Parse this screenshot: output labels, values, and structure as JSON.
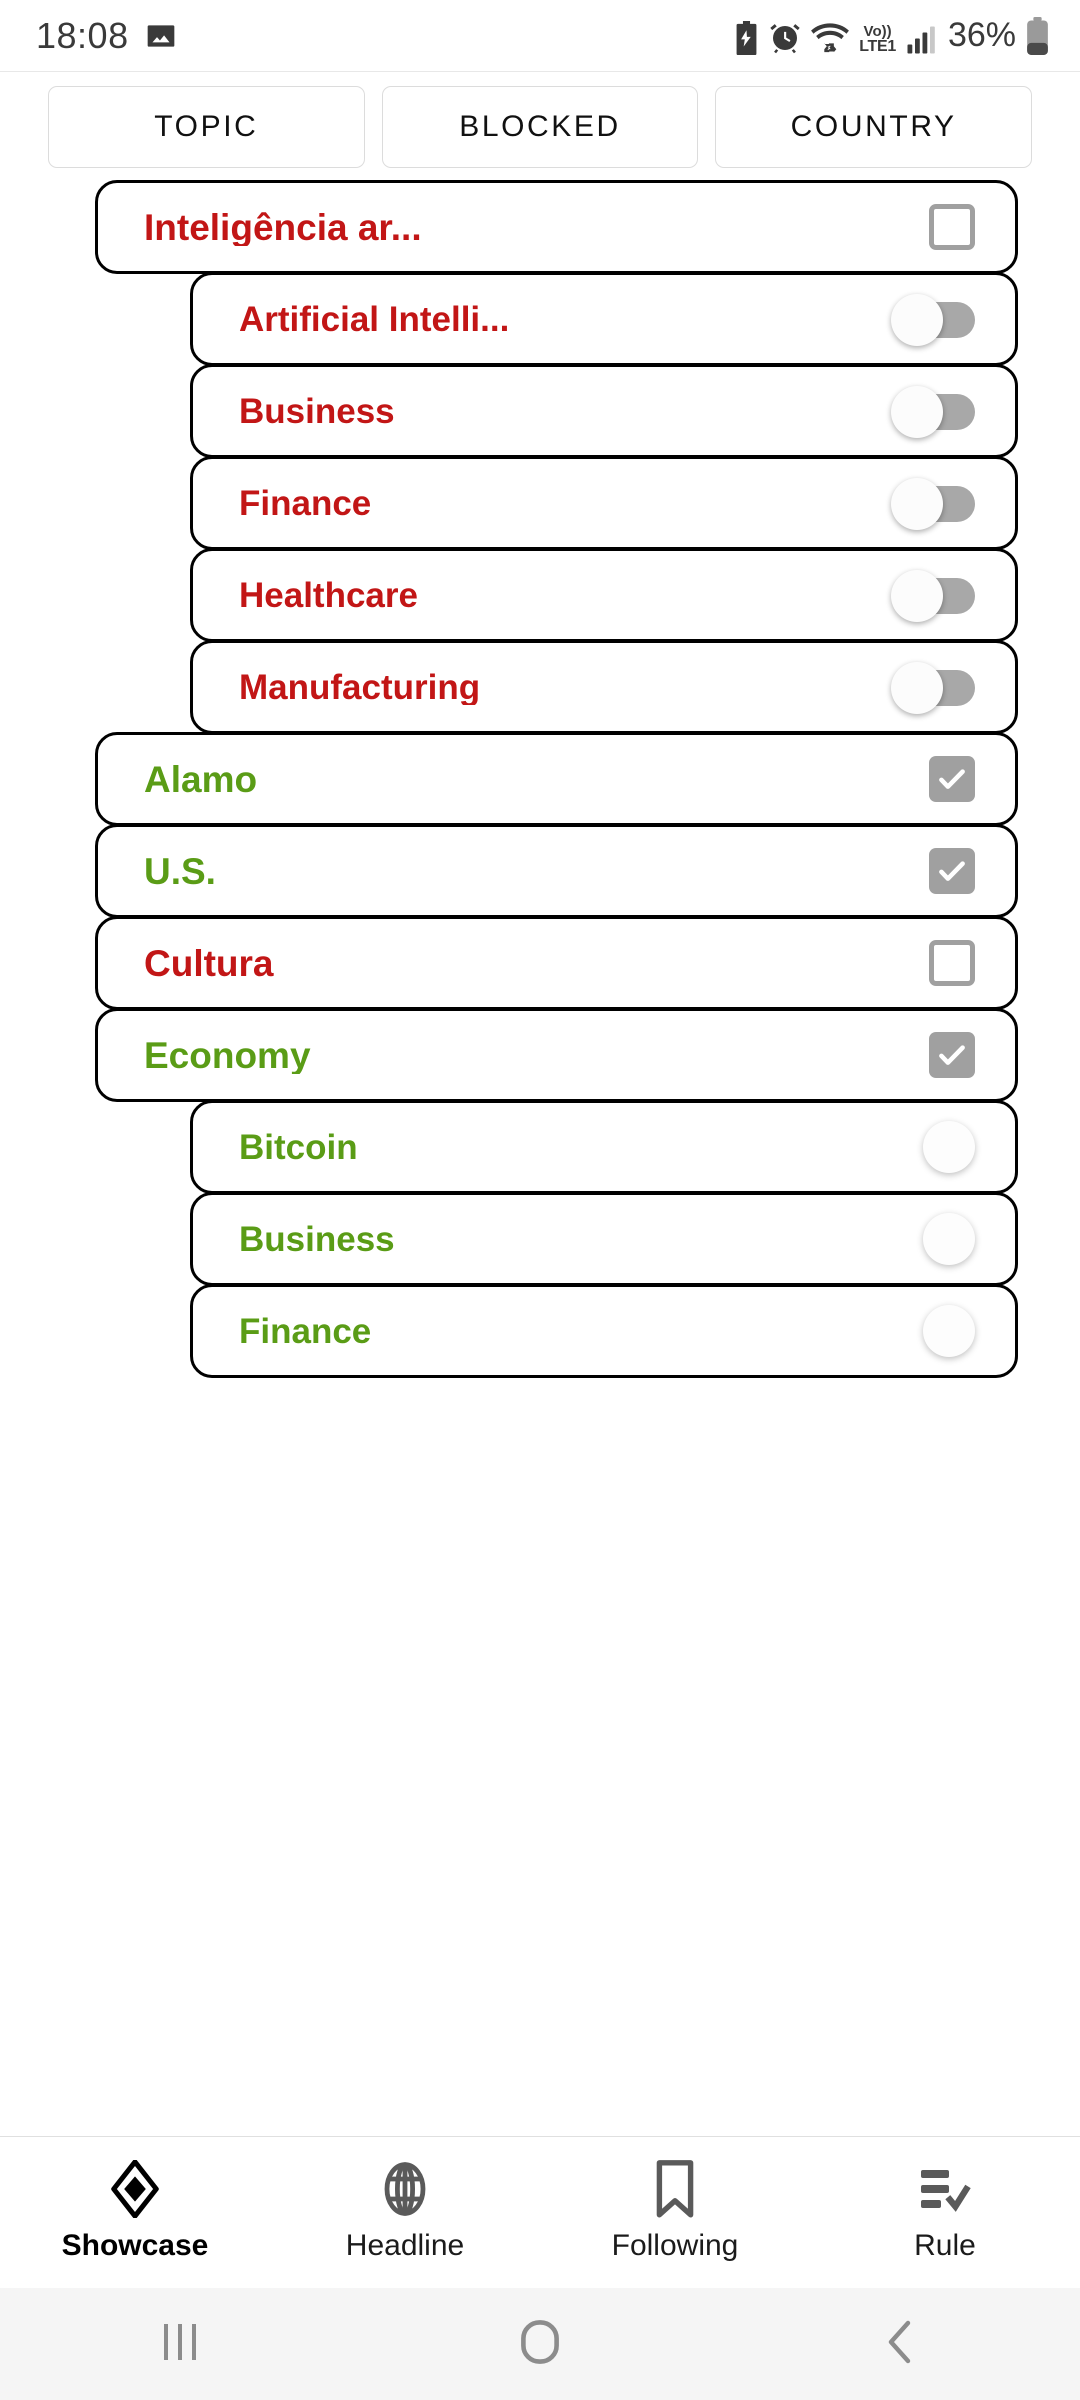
{
  "statusbar": {
    "time": "18:08",
    "battery_percent": "36%",
    "network_label_top": "Vo))",
    "network_label_bottom": "LTE1",
    "icons": [
      "image-icon",
      "battery-saver-icon",
      "alarm-icon",
      "wifi-icon",
      "volte-icon",
      "signal-icon",
      "battery-icon"
    ]
  },
  "tabs": [
    {
      "label": "TOPIC",
      "active": false
    },
    {
      "label": "BLOCKED",
      "active": false
    },
    {
      "label": "COUNTRY",
      "active": false
    }
  ],
  "colors": {
    "red": "#c21616",
    "green": "#5a9c16",
    "border": "#000000",
    "control_gray": "#a0a0a0",
    "tab_border": "#dcdcdc"
  },
  "list": [
    {
      "label": "Inteligência ar...",
      "color": "red",
      "level": 0,
      "control": "checkbox",
      "checked": false
    },
    {
      "label": "Artificial Intelli...",
      "color": "red",
      "level": 1,
      "control": "toggle",
      "checked": false
    },
    {
      "label": "Business",
      "color": "red",
      "level": 1,
      "control": "toggle",
      "checked": false
    },
    {
      "label": "Finance",
      "color": "red",
      "level": 1,
      "control": "toggle",
      "checked": false
    },
    {
      "label": "Healthcare",
      "color": "red",
      "level": 1,
      "control": "toggle",
      "checked": false
    },
    {
      "label": "Manufacturing",
      "color": "red",
      "level": 1,
      "control": "toggle",
      "checked": false
    },
    {
      "label": "Alamo",
      "color": "green",
      "level": 0,
      "control": "checkbox",
      "checked": true
    },
    {
      "label": "U.S.",
      "color": "green",
      "level": 0,
      "control": "checkbox",
      "checked": true
    },
    {
      "label": "Cultura",
      "color": "red",
      "level": 0,
      "control": "checkbox",
      "checked": false
    },
    {
      "label": "Economy",
      "color": "green",
      "level": 0,
      "control": "checkbox",
      "checked": true
    },
    {
      "label": "Bitcoin",
      "color": "green",
      "level": 1,
      "control": "circle",
      "checked": false
    },
    {
      "label": "Business",
      "color": "green",
      "level": 1,
      "control": "circle",
      "checked": false
    },
    {
      "label": "Finance",
      "color": "green",
      "level": 1,
      "control": "circle",
      "checked": false
    }
  ],
  "bottomnav": [
    {
      "label": "Showcase",
      "icon": "diamond-icon",
      "active": true
    },
    {
      "label": "Headline",
      "icon": "globe-icon",
      "active": false
    },
    {
      "label": "Following",
      "icon": "bookmark-icon",
      "active": false
    },
    {
      "label": "Rule",
      "icon": "list-check-icon",
      "active": false
    }
  ],
  "sysnav": [
    {
      "name": "recents-button",
      "icon": "recents-icon"
    },
    {
      "name": "home-button",
      "icon": "home-icon"
    },
    {
      "name": "back-button",
      "icon": "back-icon"
    }
  ]
}
